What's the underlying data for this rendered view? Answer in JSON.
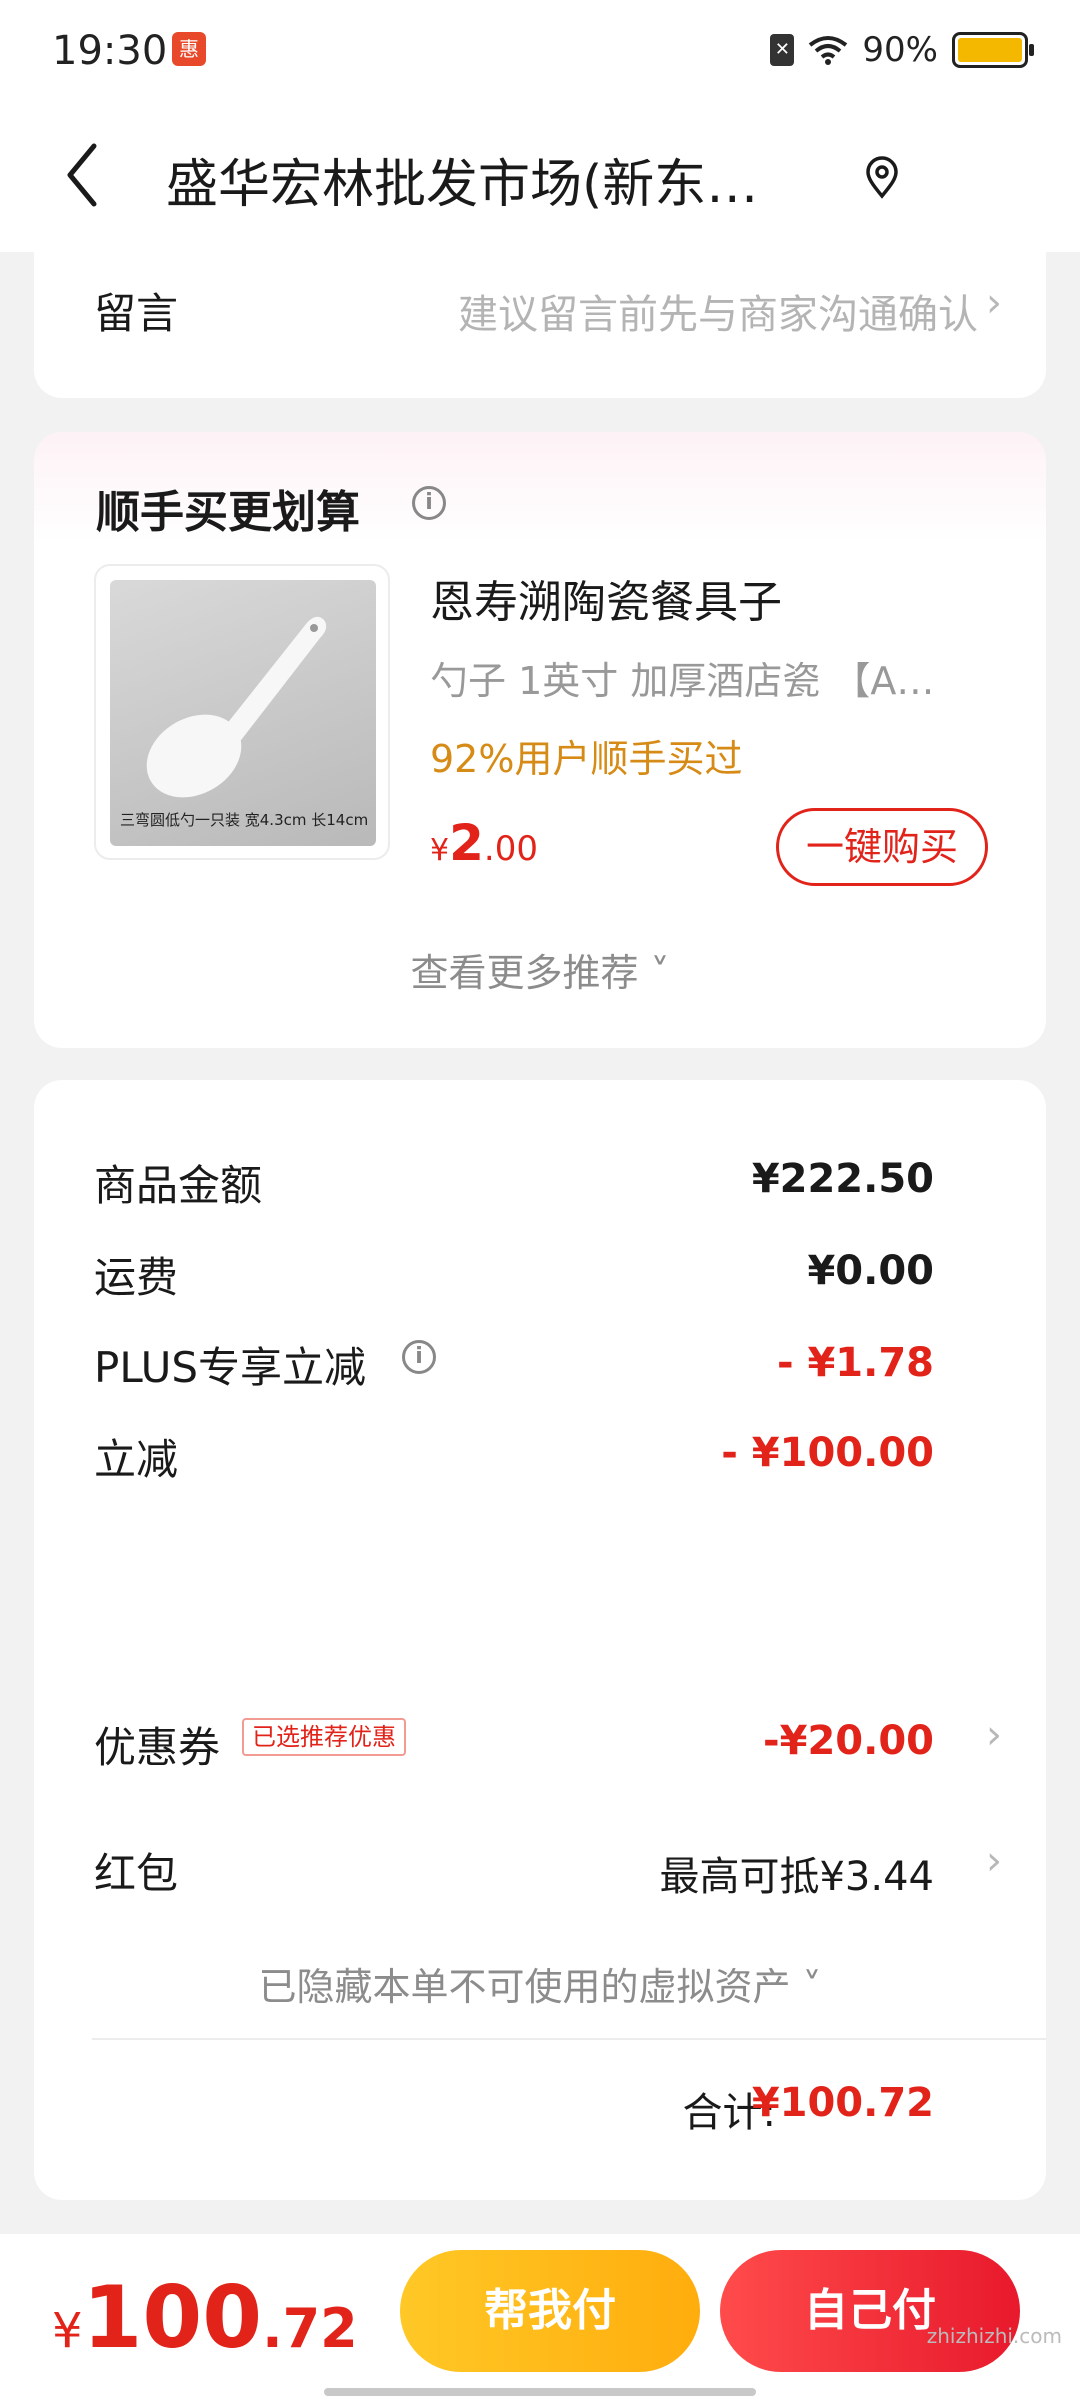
{
  "status_bar": {
    "time": "19:30",
    "app_icon_text": "惠",
    "sim_icon_text": "✕",
    "battery": "90%",
    "battery_level": 0.9
  },
  "header": {
    "title": "盛华宏林批发市场(新东…",
    "back_icon": "chevron-left-icon",
    "location_icon": "location-pin-icon"
  },
  "message": {
    "label": "留言",
    "placeholder": "建议留言前先与商家沟通确认"
  },
  "recommend": {
    "title": "顺手买更划算",
    "product": {
      "name": "恩寿溯陶瓷餐具子",
      "specs": "勺子   1英寸 加厚酒店瓷   【A…",
      "social_proof": "92%用户顺手买过",
      "price_symbol": "¥",
      "price_int": "2",
      "price_dec": ".00",
      "image_caption": "三弯圆低勺一只装 宽4.3cm 长14cm",
      "buy_label": "一键购买"
    },
    "more_label": "查看更多推荐 ˅"
  },
  "summary": {
    "rows": [
      {
        "label": "商品金额",
        "value": "¥222.50"
      },
      {
        "label": "运费",
        "value": "¥0.00"
      },
      {
        "label": "PLUS专享立减",
        "value": "- ¥1.78"
      },
      {
        "label": "立减",
        "value": "- ¥100.00"
      },
      {
        "label": "优惠券",
        "value": "-¥20.00",
        "tag": "已选推荐优惠"
      },
      {
        "label": "红包",
        "value": "最高可抵¥3.44"
      }
    ],
    "hidden_assets": "已隐藏本单不可使用的虚拟资产 ˅",
    "total_label": "合计:",
    "total_value": "¥100.72"
  },
  "bottom_bar": {
    "price_symbol": "¥",
    "price_int": "100",
    "price_dec": ".72",
    "help_pay_label": "帮我付",
    "self_pay_label": "自己付",
    "watermark": "zhizhizhi.com"
  },
  "colors": {
    "accent_red": "#e2231a",
    "accent_orange": "#d78b17",
    "help_pay_yellow": "#ffc826",
    "battery_yellow": "#f5b800"
  }
}
